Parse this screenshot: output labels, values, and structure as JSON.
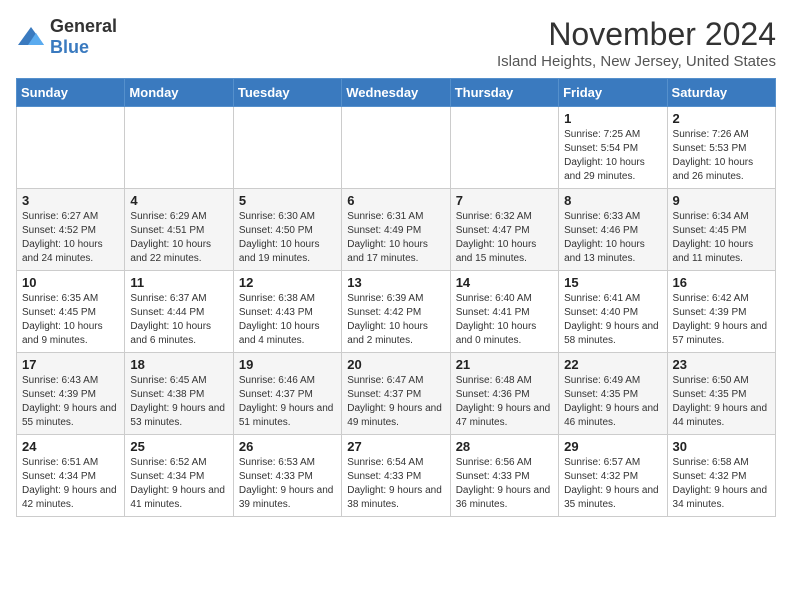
{
  "logo": {
    "general": "General",
    "blue": "Blue"
  },
  "title": "November 2024",
  "location": "Island Heights, New Jersey, United States",
  "days_of_week": [
    "Sunday",
    "Monday",
    "Tuesday",
    "Wednesday",
    "Thursday",
    "Friday",
    "Saturday"
  ],
  "weeks": [
    [
      {
        "day": "",
        "info": ""
      },
      {
        "day": "",
        "info": ""
      },
      {
        "day": "",
        "info": ""
      },
      {
        "day": "",
        "info": ""
      },
      {
        "day": "",
        "info": ""
      },
      {
        "day": "1",
        "info": "Sunrise: 7:25 AM\nSunset: 5:54 PM\nDaylight: 10 hours and 29 minutes."
      },
      {
        "day": "2",
        "info": "Sunrise: 7:26 AM\nSunset: 5:53 PM\nDaylight: 10 hours and 26 minutes."
      }
    ],
    [
      {
        "day": "3",
        "info": "Sunrise: 6:27 AM\nSunset: 4:52 PM\nDaylight: 10 hours and 24 minutes."
      },
      {
        "day": "4",
        "info": "Sunrise: 6:29 AM\nSunset: 4:51 PM\nDaylight: 10 hours and 22 minutes."
      },
      {
        "day": "5",
        "info": "Sunrise: 6:30 AM\nSunset: 4:50 PM\nDaylight: 10 hours and 19 minutes."
      },
      {
        "day": "6",
        "info": "Sunrise: 6:31 AM\nSunset: 4:49 PM\nDaylight: 10 hours and 17 minutes."
      },
      {
        "day": "7",
        "info": "Sunrise: 6:32 AM\nSunset: 4:47 PM\nDaylight: 10 hours and 15 minutes."
      },
      {
        "day": "8",
        "info": "Sunrise: 6:33 AM\nSunset: 4:46 PM\nDaylight: 10 hours and 13 minutes."
      },
      {
        "day": "9",
        "info": "Sunrise: 6:34 AM\nSunset: 4:45 PM\nDaylight: 10 hours and 11 minutes."
      }
    ],
    [
      {
        "day": "10",
        "info": "Sunrise: 6:35 AM\nSunset: 4:45 PM\nDaylight: 10 hours and 9 minutes."
      },
      {
        "day": "11",
        "info": "Sunrise: 6:37 AM\nSunset: 4:44 PM\nDaylight: 10 hours and 6 minutes."
      },
      {
        "day": "12",
        "info": "Sunrise: 6:38 AM\nSunset: 4:43 PM\nDaylight: 10 hours and 4 minutes."
      },
      {
        "day": "13",
        "info": "Sunrise: 6:39 AM\nSunset: 4:42 PM\nDaylight: 10 hours and 2 minutes."
      },
      {
        "day": "14",
        "info": "Sunrise: 6:40 AM\nSunset: 4:41 PM\nDaylight: 10 hours and 0 minutes."
      },
      {
        "day": "15",
        "info": "Sunrise: 6:41 AM\nSunset: 4:40 PM\nDaylight: 9 hours and 58 minutes."
      },
      {
        "day": "16",
        "info": "Sunrise: 6:42 AM\nSunset: 4:39 PM\nDaylight: 9 hours and 57 minutes."
      }
    ],
    [
      {
        "day": "17",
        "info": "Sunrise: 6:43 AM\nSunset: 4:39 PM\nDaylight: 9 hours and 55 minutes."
      },
      {
        "day": "18",
        "info": "Sunrise: 6:45 AM\nSunset: 4:38 PM\nDaylight: 9 hours and 53 minutes."
      },
      {
        "day": "19",
        "info": "Sunrise: 6:46 AM\nSunset: 4:37 PM\nDaylight: 9 hours and 51 minutes."
      },
      {
        "day": "20",
        "info": "Sunrise: 6:47 AM\nSunset: 4:37 PM\nDaylight: 9 hours and 49 minutes."
      },
      {
        "day": "21",
        "info": "Sunrise: 6:48 AM\nSunset: 4:36 PM\nDaylight: 9 hours and 47 minutes."
      },
      {
        "day": "22",
        "info": "Sunrise: 6:49 AM\nSunset: 4:35 PM\nDaylight: 9 hours and 46 minutes."
      },
      {
        "day": "23",
        "info": "Sunrise: 6:50 AM\nSunset: 4:35 PM\nDaylight: 9 hours and 44 minutes."
      }
    ],
    [
      {
        "day": "24",
        "info": "Sunrise: 6:51 AM\nSunset: 4:34 PM\nDaylight: 9 hours and 42 minutes."
      },
      {
        "day": "25",
        "info": "Sunrise: 6:52 AM\nSunset: 4:34 PM\nDaylight: 9 hours and 41 minutes."
      },
      {
        "day": "26",
        "info": "Sunrise: 6:53 AM\nSunset: 4:33 PM\nDaylight: 9 hours and 39 minutes."
      },
      {
        "day": "27",
        "info": "Sunrise: 6:54 AM\nSunset: 4:33 PM\nDaylight: 9 hours and 38 minutes."
      },
      {
        "day": "28",
        "info": "Sunrise: 6:56 AM\nSunset: 4:33 PM\nDaylight: 9 hours and 36 minutes."
      },
      {
        "day": "29",
        "info": "Sunrise: 6:57 AM\nSunset: 4:32 PM\nDaylight: 9 hours and 35 minutes."
      },
      {
        "day": "30",
        "info": "Sunrise: 6:58 AM\nSunset: 4:32 PM\nDaylight: 9 hours and 34 minutes."
      }
    ]
  ]
}
